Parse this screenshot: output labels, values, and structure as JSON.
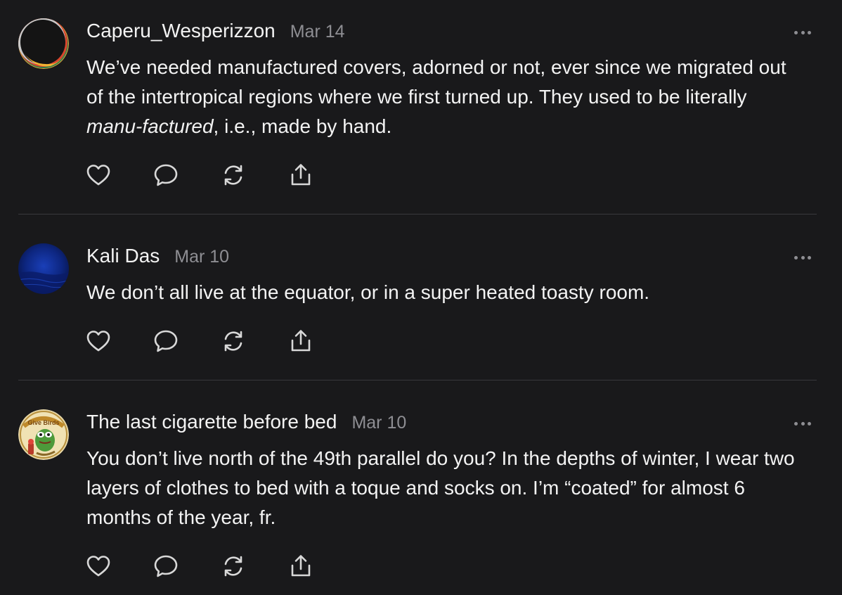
{
  "comments": [
    {
      "author": "Caperu_Wesperizzon",
      "date": "Mar 14",
      "text_before": "We’ve needed manufactured covers, adorned or not, ever since we migrated out of the intertropical regions where we first turned up. They used to be literally ",
      "text_emphasis": "manu-factured",
      "text_after": ", i.e., made by hand.",
      "avatar": "dark-circle-with-colored-rim",
      "actions": [
        "heart-icon",
        "comment-icon",
        "repost-icon",
        "share-icon"
      ]
    },
    {
      "author": "Kali Das",
      "date": "Mar 10",
      "text": "We don’t all live at the equator, or in a super heated toasty room.",
      "avatar": "deep-blue-ocean",
      "actions": [
        "heart-icon",
        "comment-icon",
        "repost-icon",
        "share-icon"
      ]
    },
    {
      "author": "The last cigarette before bed",
      "date": "Mar 10",
      "text": "You don’t live north of the 49th parallel do you? In the depths of winter, I wear two layers of clothes to bed with a toque and socks on. I’m “coated” for almost 6 months of the year, fr.",
      "avatar": "green-frog-badge",
      "avatar_badge_text": "Give Birds",
      "actions": [
        "heart-icon",
        "comment-icon",
        "repost-icon",
        "share-icon"
      ]
    }
  ],
  "colors": {
    "background": "#19191b",
    "text": "#f3f3f3",
    "muted": "#8e8e93",
    "divider": "#38383c"
  }
}
